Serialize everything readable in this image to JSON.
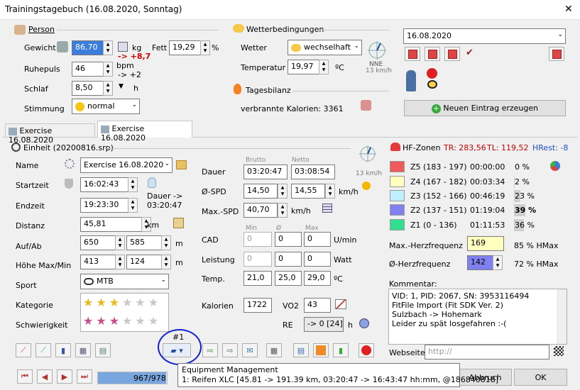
{
  "window": {
    "title": "Trainingstagebuch (16.08.2020, Sonntag)",
    "close": "✕"
  },
  "person": {
    "title": "Person",
    "gewicht_label": "Gewicht",
    "gewicht": "86,70",
    "gewicht_unit": "kg",
    "gewicht_delta": "-> +8,7",
    "fett_label": "Fett",
    "fett": "19,29",
    "fett_unit": "%",
    "ruhepuls_label": "Ruhepuls",
    "ruhepuls": "46",
    "ruhepuls_unit": "bpm",
    "ruhepuls_delta": "-> +2",
    "schlaf_label": "Schlaf",
    "schlaf": "8,50",
    "schlaf_unit": "h",
    "stimmung_label": "Stimmung",
    "stimmung": "normal"
  },
  "wetter": {
    "title": "Wetterbedingungen",
    "wetter_label": "Wetter",
    "wetter": "wechselhaft",
    "temp_label": "Temperatur",
    "temp": "19,97",
    "temp_unit": "ºC",
    "wind_dir": "NNE",
    "wind_speed": "13 km/h"
  },
  "tagesbilanz": {
    "title": "Tagesbilanz",
    "kalorien": "verbrannte Kalorien: 3361"
  },
  "date": {
    "value": "16.08.2020",
    "new_entry": "Neuen Eintrag erzeugen"
  },
  "tabs": [
    "Exercise 16.08.2020",
    "Exercise 16.08.2020"
  ],
  "einheit": {
    "title": "Einheit (20200816.srp)",
    "name_label": "Name",
    "name": "Exercise 16.08.2020",
    "startzeit_label": "Startzeit",
    "startzeit": "16:02:43",
    "endzeit_label": "Endzeit",
    "endzeit": "19:23:30",
    "dauer_note": "Dauer -> 03:20:47",
    "distanz_label": "Distanz",
    "distanz": "45,81",
    "distanz_unit": "km",
    "aufab_label": "Auf/Ab",
    "auf": "650",
    "ab": "585",
    "aufab_unit": "m",
    "hoehe_label": "Höhe Max/Min",
    "hoehe_max": "413",
    "hoehe_min": "124",
    "hoehe_unit": "m",
    "sport_label": "Sport",
    "sport": "MTB",
    "kategorie_label": "Kategorie",
    "schwierigkeit_label": "Schwierigkeit",
    "kategorie_stars": 3,
    "schwierigkeit_stars": 3
  },
  "stats": {
    "brutto": "Brutto",
    "netto": "Netto",
    "dauer_label": "Dauer",
    "dauer_brutto": "03:20:47",
    "dauer_netto": "03:08:54",
    "spd_label": "Ø-SPD",
    "spd_brutto": "14,50",
    "spd_netto": "14,55",
    "spd_unit": "km/h",
    "maxspd_label": "Max.-SPD",
    "maxspd": "40,70",
    "maxspd_unit": "km/h",
    "min": "Min",
    "avg": "Ø",
    "max": "Max",
    "cad_label": "CAD",
    "cad_min": "0",
    "cad_avg": "0",
    "cad_max": "0",
    "cad_unit": "U/min",
    "leistung_label": "Leistung",
    "leistung_min": "0",
    "leistung_avg": "0",
    "leistung_max": "0",
    "leistung_unit": "Watt",
    "temp_label": "Temp.",
    "temp_min": "21,0",
    "temp_avg": "25,0",
    "temp_max": "29,0",
    "temp_unit": "ºC",
    "kalorien_label": "Kalorien",
    "kalorien": "1722",
    "vo2_label": "VO2",
    "vo2": "43",
    "re_label": "RE",
    "re": "-> 0 [24]",
    "re_unit": "h",
    "wind_speed": "13 km/h"
  },
  "hf": {
    "title": "HF-Zonen",
    "tr": "TR: 283,56",
    "tl": "TL: 119,52",
    "hrest": "HRest: -8",
    "zones": [
      {
        "name": "Z5 (183 - 197)",
        "time": "00:00:00",
        "pct": "0 %",
        "color": "#f05a5a",
        "fill": 0
      },
      {
        "name": "Z4 (167 - 182)",
        "time": "00:03:34",
        "pct": "2 %",
        "color": "#ffffc0",
        "fill": 0.02
      },
      {
        "name": "Z3 (152 - 166)",
        "time": "00:46:19",
        "pct": "23 %",
        "color": "#c0f0ff",
        "fill": 0.23
      },
      {
        "name": "Z2 (137 - 151)",
        "time": "01:19:04",
        "pct": "39 %",
        "color": "#8080f0",
        "fill": 0.39
      },
      {
        "name": "Z1 (0 - 136)",
        "time": "01:11:53",
        "pct": "36 %",
        "color": "#30e090",
        "fill": 0.36
      }
    ],
    "maxhf_label": "Max.-Herzfrequenz",
    "maxhf": "169",
    "maxhf_pct": "85 % HMax",
    "avghf_label": "Ø-Herzfrequenz",
    "avghf": "142",
    "avghf_pct": "72 % HMax"
  },
  "kommentar": {
    "label": "Kommentar:",
    "lines": [
      "VID: 1, PID: 2067, SN: 3953116494",
      "FitFile Import (Fit SDK Ver. 2)",
      "Sulzbach -> Hohemark",
      "Leider zu spät losgefahren :-("
    ],
    "webseite_label": "Webseite:",
    "webseite": "http://"
  },
  "equipment": {
    "badge": "#1",
    "tooltip_title": "Equipment Management",
    "tooltip_text": "1: Reifen XLC [45.81 -> 191.39 km, 03:20:47 -> 16:43:47 hh:mm, @186840818]"
  },
  "nav": {
    "progress": "967/978",
    "progress_value": 0.989
  },
  "buttons": {
    "abbruch": "Abbruch",
    "ok": "OK"
  }
}
